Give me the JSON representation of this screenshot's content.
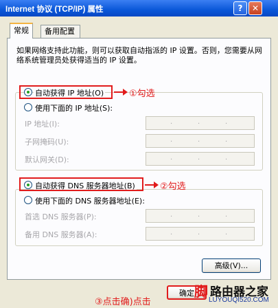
{
  "window": {
    "title": "Internet 协议 (TCP/IP) 属性",
    "help": "?",
    "close": "✕"
  },
  "tabs": [
    {
      "label": "常规"
    },
    {
      "label": "备用配置"
    }
  ],
  "description": "如果网络支持此功能，则可以获取自动指派的 IP 设置。否则，您需要从网络系统管理员处获得适当的 IP 设置。",
  "ip": {
    "auto_label": "自动获得 IP 地址(O)",
    "manual_label": "使用下面的 IP 地址(S):",
    "fields": [
      {
        "label": "IP 地址(I):"
      },
      {
        "label": "子网掩码(U):"
      },
      {
        "label": "默认网关(D):"
      }
    ]
  },
  "dns": {
    "auto_label": "自动获得 DNS 服务器地址(B)",
    "manual_label": "使用下面的 DNS 服务器地址(E):",
    "fields": [
      {
        "label": "首选 DNS 服务器(P):"
      },
      {
        "label": "备用 DNS 服务器(A):"
      }
    ]
  },
  "buttons": {
    "advanced": "高级(V)...",
    "ok": "确定"
  },
  "annotations": {
    "step1": "①勾选",
    "step2": "②勾选",
    "step3": "③点击确)点击"
  },
  "watermark": {
    "mark": "脚",
    "brand": "路由器之家",
    "url": "LUYOUQI520.COM"
  },
  "colors": {
    "annotation_red": "#e11b1b",
    "titlebar_blue": "#0a57d8",
    "radio_green": "#21a121"
  }
}
